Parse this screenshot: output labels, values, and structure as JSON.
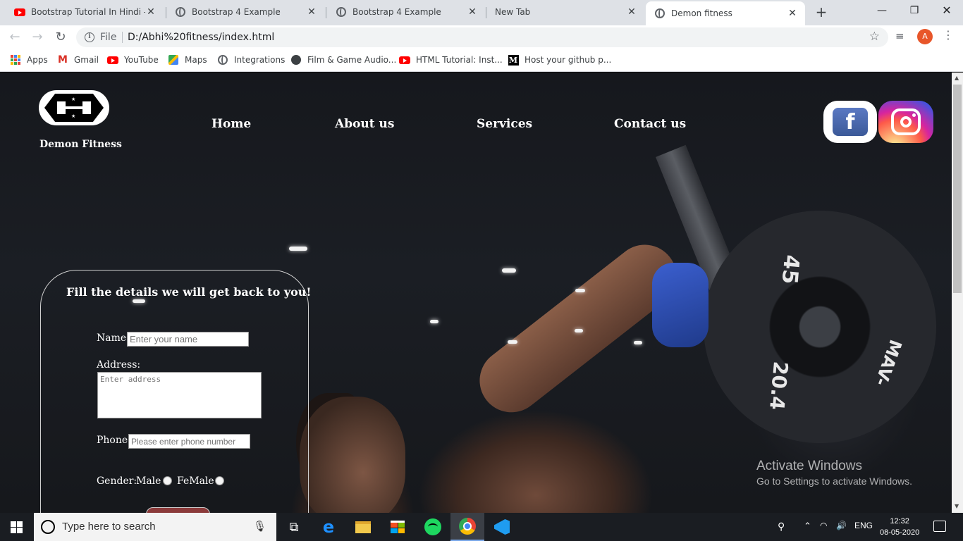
{
  "browser": {
    "tabs": [
      {
        "title": "Bootstrap Tutorial In Hindi - Yo",
        "favicon": "youtube-icon",
        "active": false
      },
      {
        "title": "Bootstrap 4 Example",
        "favicon": "globe-icon",
        "active": false
      },
      {
        "title": "Bootstrap 4 Example",
        "favicon": "globe-icon",
        "active": false
      },
      {
        "title": "New Tab",
        "favicon": "none",
        "active": false
      },
      {
        "title": "Demon fitness",
        "favicon": "globe-icon",
        "active": true
      }
    ],
    "address": {
      "scheme_label": "File",
      "url": "D:/Abhi%20fitness/index.html"
    },
    "profile_initial": "A",
    "bookmarks": [
      {
        "label": "Apps",
        "icon": "apps-grid-icon"
      },
      {
        "label": "Gmail",
        "icon": "gmail-icon"
      },
      {
        "label": "YouTube",
        "icon": "youtube-icon"
      },
      {
        "label": "Maps",
        "icon": "maps-icon"
      },
      {
        "label": "Integrations",
        "icon": "globe-icon"
      },
      {
        "label": "Film & Game Audio...",
        "icon": "audio-icon"
      },
      {
        "label": "HTML Tutorial: Inst...",
        "icon": "youtube-icon"
      },
      {
        "label": "Host your github p...",
        "icon": "medium-icon"
      }
    ]
  },
  "site": {
    "brand": "Demon Fitness",
    "nav": [
      "Home",
      "About us",
      "Services",
      "Contact us"
    ],
    "social": [
      {
        "name": "facebook",
        "glyph": "f",
        "icon": "facebook-icon",
        "color": "#3b5998"
      },
      {
        "name": "instagram",
        "icon": "instagram-icon",
        "color": "#d6249f"
      }
    ],
    "hero": {
      "plate_top": "45",
      "plate_side": "MAV-",
      "plate_bottom": "20.4"
    },
    "form": {
      "title": "Fill the details we will get back to you!",
      "name_label": "Name:",
      "name_placeholder": "Enter your name",
      "address_label": "Address:",
      "address_placeholder": "Enter address",
      "phone_label": "Phone:",
      "phone_placeholder": "Please enter phone number",
      "gender_label": "Gender:",
      "gender_options": [
        "Male",
        "FeMale"
      ],
      "submit_color": "#8b3a3a"
    }
  },
  "watermark": {
    "line1": "Activate Windows",
    "line2": "Go to Settings to activate Windows."
  },
  "taskbar": {
    "search_placeholder": "Type here to search",
    "apps": [
      "task-view-icon",
      "edge-icon",
      "file-explorer-icon",
      "store-icon",
      "spotify-icon",
      "chrome-icon",
      "vscode-icon"
    ],
    "language": "ENG",
    "time": "12:32",
    "date": "08-05-2020"
  },
  "colors": {
    "tabstrip": "#dee1e6",
    "page_bg": "#16181d",
    "taskbar": "#1a1d22"
  }
}
